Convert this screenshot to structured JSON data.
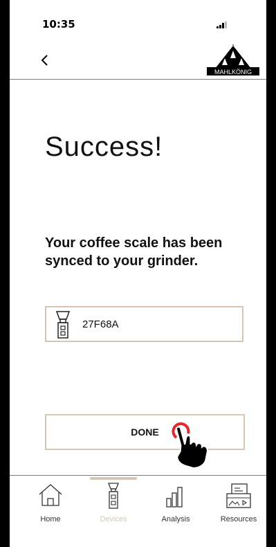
{
  "status_bar": {
    "time": "10:35"
  },
  "header": {
    "logo_text": "MAHLKÖNIG"
  },
  "main": {
    "title": "Success!",
    "message": "Your coffee scale has been synced to your grinder.",
    "device": {
      "id": "27F68A"
    },
    "done_label": "DONE"
  },
  "tabs": [
    {
      "label": "Home",
      "icon": "home-icon"
    },
    {
      "label": "Devices",
      "icon": "grinder-icon",
      "active": true
    },
    {
      "label": "Analysis",
      "icon": "bar-chart-icon"
    },
    {
      "label": "Resources",
      "icon": "resources-icon"
    }
  ],
  "colors": {
    "accent": "#d6c7b4",
    "tap_indicator": "#e5262c"
  }
}
